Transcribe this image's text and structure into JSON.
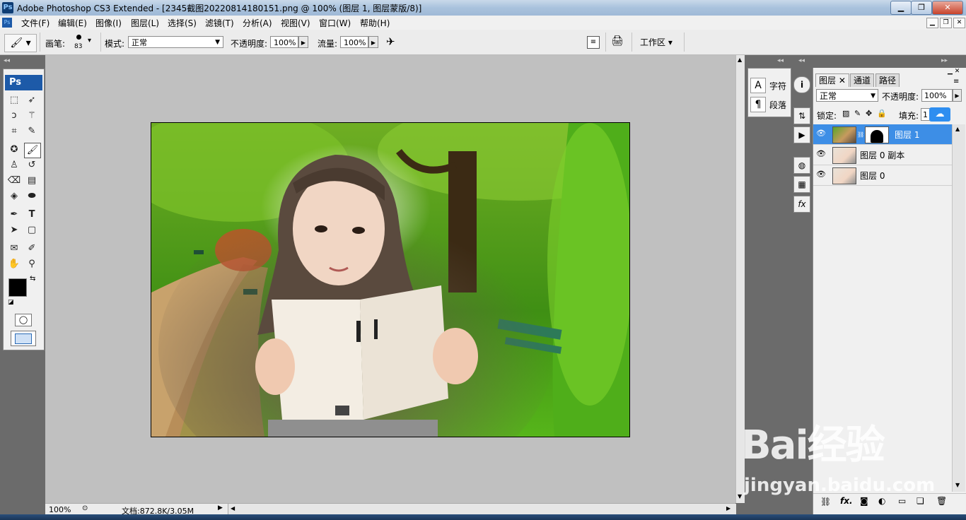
{
  "window": {
    "app_badge": "Ps",
    "title": "Adobe Photoshop CS3 Extended - [2345截图20220814180151.png @ 100% (图层 1, 图层蒙版/8)]"
  },
  "menu": [
    "文件(F)",
    "编辑(E)",
    "图像(I)",
    "图层(L)",
    "选择(S)",
    "滤镜(T)",
    "分析(A)",
    "视图(V)",
    "窗口(W)",
    "帮助(H)"
  ],
  "options": {
    "brush_label": "画笔:",
    "brush_size": "83",
    "mode_label": "模式:",
    "mode_value": "正常",
    "opacity_label": "不透明度:",
    "opacity_value": "100%",
    "flow_label": "流量:",
    "flow_value": "100%",
    "workspace_label": "工作区"
  },
  "toolbox": {
    "logo": "Ps"
  },
  "char_panel": {
    "char_label": "字符",
    "para_label": "段落"
  },
  "layers_panel": {
    "tabs": [
      "图层",
      "通道",
      "路径"
    ],
    "blend_mode": "正常",
    "opacity_label": "不透明度:",
    "opacity_value": "100%",
    "lock_label": "锁定:",
    "fill_label": "填充:",
    "fill_value": "1",
    "layers": [
      {
        "name": "图层 1",
        "selected": true,
        "has_mask": true
      },
      {
        "name": "图层 0 副本",
        "selected": false,
        "has_mask": false
      },
      {
        "name": "图层 0",
        "selected": false,
        "has_mask": false
      }
    ]
  },
  "status": {
    "zoom": "100%",
    "doc_info": "文档:872.8K/3.05M"
  },
  "watermark": {
    "brand": "Bai经验",
    "url": "jingyan.baidu.com"
  }
}
